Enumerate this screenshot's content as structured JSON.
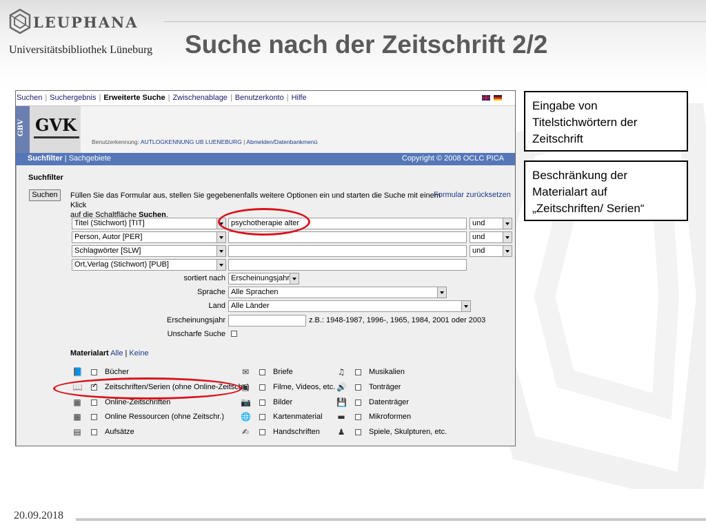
{
  "slide": {
    "brand": "LEUPHANA",
    "subtitle": "Universitätsbibliothek Lüneburg",
    "title": "Suche nach der Zeitschrift 2/2",
    "date": "20.09.2018"
  },
  "callouts": [
    "Eingabe von Titelstichwörtern der Zeitschrift",
    "Beschränkung der Materialart auf „Zeitschriften/ Serien“"
  ],
  "topnav": {
    "items": [
      "Suchen",
      "Suchergebnis",
      "Erweiterte Suche",
      "Zwischenablage",
      "Benutzerkonto",
      "Hilfe"
    ],
    "active": "Erweiterte Suche"
  },
  "banner": {
    "gbv": "GBV",
    "gvk": "GVK",
    "user_label": "Benutzerkennung:",
    "user_value": "AUTLOGKENNUNG UB LUENEBURG",
    "user_sep": "|",
    "user_link": "Abmelden/Datenbankmenü"
  },
  "bluebar": {
    "active": "Suchfilter",
    "sep": "|",
    "other": "Sachgebiete",
    "copyright": "Copyright © 2008 OCLC PICA"
  },
  "form": {
    "section": "Suchfilter",
    "search_button": "Suchen",
    "instruction_1": "Füllen Sie das Formular aus, stellen Sie gegebenenfalls weitere Optionen ein und starten die Suche mit einem Klick",
    "instruction_2a": "auf die Schaltfläche ",
    "instruction_2b": "Suchen",
    "instruction_2c": ".",
    "reset": "Formular zurücksetzen",
    "rows": [
      {
        "field": "Titel (Stichwort) [TIT]",
        "value": "psychotherapie alter",
        "op": "und"
      },
      {
        "field": "Person, Autor [PER]",
        "value": "",
        "op": "und"
      },
      {
        "field": "Schlagwörter [SLW]",
        "value": "",
        "op": "und"
      },
      {
        "field": "Ort,Verlag (Stichwort) [PUB]",
        "value": "",
        "op": ""
      }
    ],
    "sort_label": "sortiert nach",
    "sort_value": "Erscheinungsjahr",
    "lang_label": "Sprache",
    "lang_value": "Alle Sprachen",
    "country_label": "Land",
    "country_value": "Alle Länder",
    "year_label": "Erscheinungsjahr",
    "year_hint": "z.B.: 1948-1987, 1996-, 1965, 1984, 2001 oder 2003",
    "fuzzy_label": "Unscharfe Suche"
  },
  "material": {
    "label": "Materialart",
    "all": "Alle",
    "none": "Keine",
    "col1": [
      {
        "label": "Bücher",
        "icon": "book-icon",
        "checked": false
      },
      {
        "label": "Zeitschriften/Serien (ohne Online-Zeitschr.)",
        "icon": "journal-icon",
        "checked": true
      },
      {
        "label": "Online-Zeitschriften",
        "icon": "online-journal-icon",
        "checked": false
      },
      {
        "label": "Online Ressourcen (ohne Zeitschr.)",
        "icon": "online-resource-icon",
        "checked": false
      },
      {
        "label": "Aufsätze",
        "icon": "article-icon",
        "checked": false
      }
    ],
    "col2": [
      {
        "label": "Briefe",
        "icon": "letter-icon",
        "checked": false
      },
      {
        "label": "Filme, Videos, etc.",
        "icon": "film-icon",
        "checked": false
      },
      {
        "label": "Bilder",
        "icon": "camera-icon",
        "checked": false
      },
      {
        "label": "Kartenmaterial",
        "icon": "globe-icon",
        "checked": false
      },
      {
        "label": "Handschriften",
        "icon": "manuscript-icon",
        "checked": false
      }
    ],
    "col3": [
      {
        "label": "Musikalien",
        "icon": "music-icon",
        "checked": false
      },
      {
        "label": "Tonträger",
        "icon": "speaker-icon",
        "checked": false
      },
      {
        "label": "Datenträger",
        "icon": "disk-icon",
        "checked": false
      },
      {
        "label": "Mikroformen",
        "icon": "microform-icon",
        "checked": false
      },
      {
        "label": "Spiele, Skulpturen, etc.",
        "icon": "sculpture-icon",
        "checked": false
      }
    ]
  },
  "colors": {
    "bluebar": "#5577b8",
    "highlight": "#d8141c",
    "title": "#5a5a5a"
  }
}
